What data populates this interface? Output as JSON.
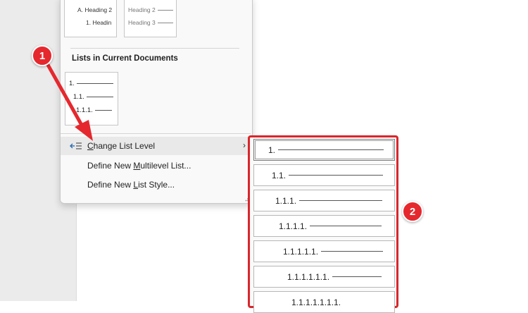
{
  "colors": {
    "accent_red": "#e5282e",
    "menu_bg": "#f9f9f9",
    "hover_bg": "#e9e9e9"
  },
  "top_thumbnails": {
    "left": {
      "rows": [
        "A. Heading 2",
        "1. Headin"
      ]
    },
    "right": {
      "rows": [
        "Heading 2",
        "Heading 3"
      ]
    }
  },
  "section": {
    "title": "Lists in Current Documents"
  },
  "current_list_thumbnail": {
    "rows": [
      "1.",
      "1.1.",
      "1.1.1."
    ]
  },
  "menu": {
    "change_level": {
      "accel": "C",
      "rest": "hange List Level",
      "icon": "change-level-icon",
      "chevron": "›"
    },
    "define_multilevel": {
      "pre": "Define New ",
      "accel": "M",
      "rest": "ultilevel List..."
    },
    "define_style": {
      "pre": "Define New ",
      "accel": "L",
      "rest": "ist Style..."
    }
  },
  "submenu": {
    "levels": [
      "1.",
      "1.1.",
      "1.1.1.",
      "1.1.1.1.",
      "1.1.1.1.1.",
      "1.1.1.1.1.1.",
      "1.1.1.1.1.1.1."
    ]
  },
  "callouts": {
    "one": "1",
    "two": "2"
  }
}
